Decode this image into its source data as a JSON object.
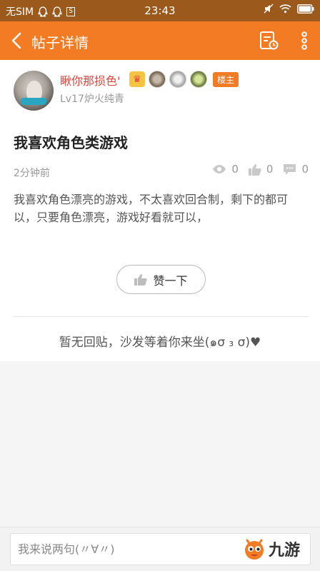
{
  "status_bar": {
    "carrier": "无SIM",
    "time": "23:43",
    "sim_box": "S"
  },
  "app_bar": {
    "title": "帖子详情",
    "accent_color": "#f27b23"
  },
  "post": {
    "author": {
      "name": "瞅你那损色'",
      "level": "Lv17炉火纯青",
      "host_tag": "楼主"
    },
    "title": "我喜欢角色类游戏",
    "time": "2分钟前",
    "stats": {
      "views": "0",
      "likes": "0",
      "comments": "0"
    },
    "body": "我喜欢角色漂亮的游戏，不太喜欢回合制，剩下的都可以，只要角色漂亮，游戏好看就可以，",
    "like_button_label": "赞一下"
  },
  "replies": {
    "empty_text": "暂无回贴，沙发等着你来坐(๑σ ₃ σ)♥"
  },
  "bottom_bar": {
    "input_placeholder": "我来说两句(〃∀〃)",
    "brand_name": "九游"
  }
}
